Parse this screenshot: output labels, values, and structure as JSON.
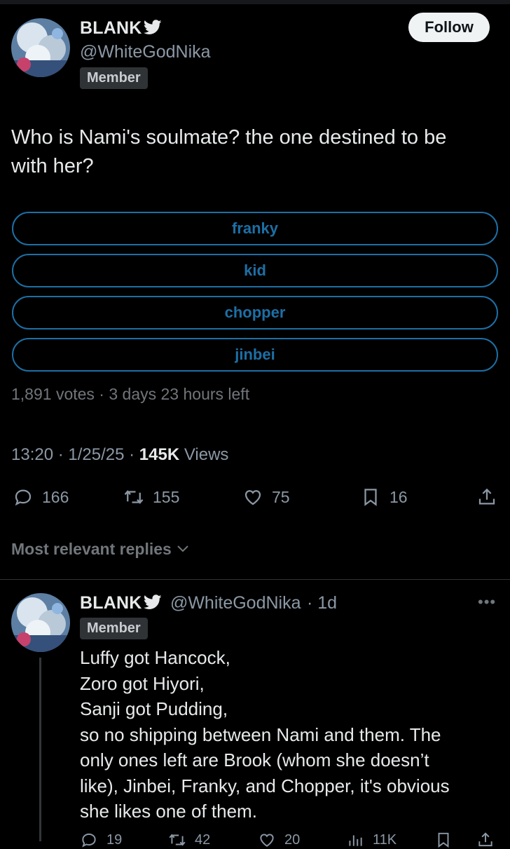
{
  "tweet": {
    "author_name": "BLANK",
    "author_handle": "@WhiteGodNika",
    "badge": "Member",
    "follow_label": "Follow",
    "text_line1": "Who is Nami's soulmate? the one destined to be",
    "text_line2": "with her?",
    "poll": {
      "options": [
        "franky",
        "kid",
        "chopper",
        "jinbei"
      ],
      "summary": "1,891 votes · 3 days 23 hours left"
    },
    "time": "13:20 · 1/25/25 · ",
    "views_count": "145K",
    "views_label": " Views",
    "stats": {
      "replies": "166",
      "reposts": "155",
      "likes": "75",
      "bookmarks": "16"
    },
    "icons": [
      "verified-bird-icon",
      "reply-icon",
      "repost-icon",
      "like-icon",
      "bookmark-icon",
      "share-icon"
    ]
  },
  "replies_header": "Most relevant replies",
  "reply": {
    "author_name": "BLANK",
    "author_handle": "@WhiteGodNika",
    "age": "· 1d",
    "badge": "Member",
    "lines": [
      "Luffy got Hancock,",
      "Zoro got Hiyori,",
      "Sanji got Pudding,",
      "so no shipping between Nami and them. The",
      "only ones left are Brook (whom she doesn’t",
      "like), Jinbei, Franky, and Chopper, it's obvious",
      "she likes one of them."
    ],
    "stats": {
      "replies": "19",
      "reposts": "42",
      "likes": "20",
      "views": "11K"
    }
  },
  "colors": {
    "accent": "#1d9bf0",
    "poll_border": "#1d6fa5",
    "muted": "#71767b",
    "background": "#000000"
  }
}
